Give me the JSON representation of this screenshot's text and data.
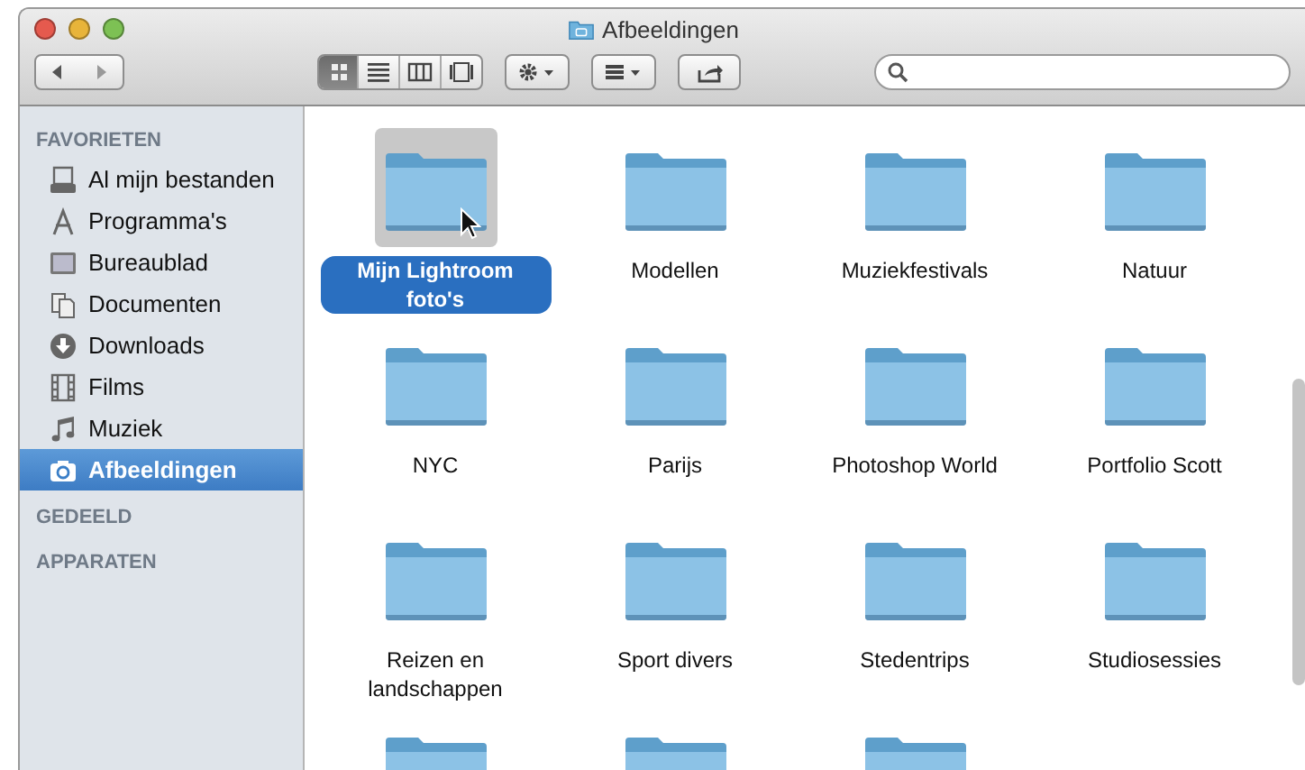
{
  "window": {
    "title": "Afbeeldingen"
  },
  "toolbar": {
    "view_buttons": [
      {
        "kind": "icons",
        "selected": true
      },
      {
        "kind": "list",
        "selected": false
      },
      {
        "kind": "columns",
        "selected": false
      },
      {
        "kind": "coverflow",
        "selected": false
      }
    ]
  },
  "sidebar": {
    "sections": [
      {
        "title": "FAVORIETEN",
        "items": [
          {
            "kind": "allfiles",
            "label": "Al mijn bestanden",
            "selected": false
          },
          {
            "kind": "apps",
            "label": "Programma's",
            "selected": false
          },
          {
            "kind": "desktop",
            "label": "Bureaublad",
            "selected": false
          },
          {
            "kind": "documents",
            "label": "Documenten",
            "selected": false
          },
          {
            "kind": "downloads",
            "label": "Downloads",
            "selected": false
          },
          {
            "kind": "movies",
            "label": "Films",
            "selected": false
          },
          {
            "kind": "music",
            "label": "Muziek",
            "selected": false
          },
          {
            "kind": "pictures",
            "label": "Afbeeldingen",
            "selected": true
          }
        ]
      },
      {
        "title": "GEDEELD"
      },
      {
        "title": "APPARATEN"
      }
    ]
  },
  "folders": [
    {
      "name": "Mijn Lightroom foto's",
      "selected": true
    },
    {
      "name": "Modellen",
      "selected": false
    },
    {
      "name": "Muziekfestivals",
      "selected": false
    },
    {
      "name": "Natuur",
      "selected": false
    },
    {
      "name": "NYC",
      "selected": false
    },
    {
      "name": "Parijs",
      "selected": false
    },
    {
      "name": "Photoshop World",
      "selected": false
    },
    {
      "name": "Portfolio Scott",
      "selected": false
    },
    {
      "name": "Reizen en landschappen",
      "selected": false
    },
    {
      "name": "Sport divers",
      "selected": false
    },
    {
      "name": "Stedentrips",
      "selected": false
    },
    {
      "name": "Studiosessies",
      "selected": false
    }
  ],
  "cut_off_folders": [
    {
      "kind": "folder"
    },
    {
      "kind": "folder"
    },
    {
      "kind": "folder"
    }
  ]
}
